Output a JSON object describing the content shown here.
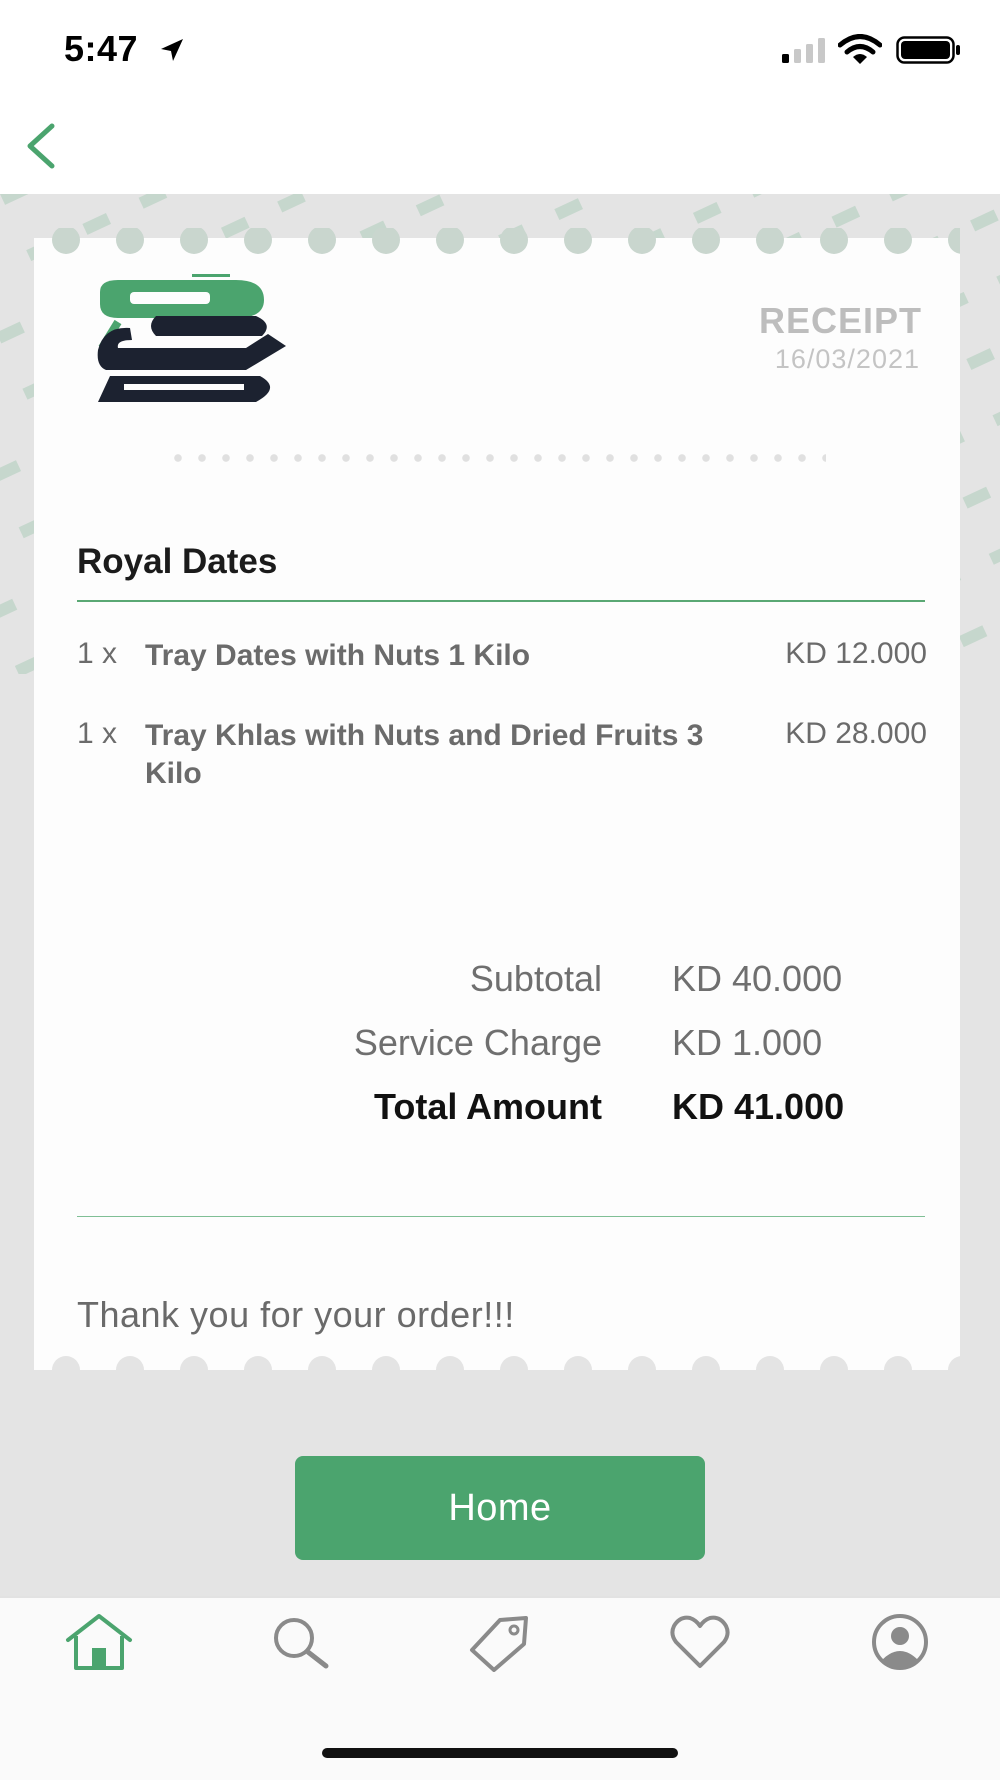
{
  "status_bar": {
    "time": "5:47"
  },
  "receipt": {
    "title": "RECEIPT",
    "date": "16/03/2021",
    "store_name": "Royal Dates",
    "items": [
      {
        "qty": "1 x",
        "name": "Tray Dates with Nuts 1 Kilo",
        "price": "KD 12.000"
      },
      {
        "qty": "1 x",
        "name": "Tray Khlas with Nuts and Dried Fruits 3 Kilo",
        "price": "KD 28.000"
      }
    ],
    "summary": {
      "subtotal_label": "Subtotal",
      "subtotal_value": "KD 40.000",
      "service_label": "Service Charge",
      "service_value": "KD 1.000",
      "total_label": "Total Amount",
      "total_value": "KD 41.000"
    },
    "thanks": "Thank you for your order!!!"
  },
  "home_button": {
    "label": "Home"
  },
  "tabs": [
    "home-icon",
    "search-icon",
    "tag-icon",
    "heart-icon",
    "account-icon"
  ],
  "colors": {
    "accent": "#4ba46e",
    "logo_dark": "#1c2230",
    "active_tab": "#4ba46e",
    "inactive_tab": "#8a8a8a"
  }
}
